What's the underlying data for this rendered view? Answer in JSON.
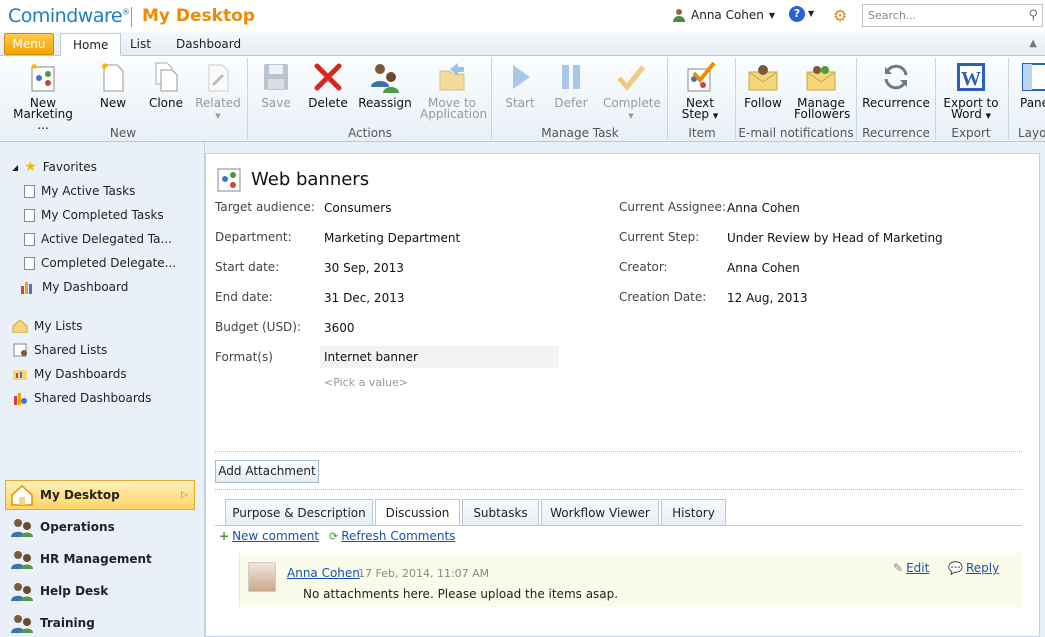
{
  "header": {
    "logo": "Comindware",
    "logo_reg": "®",
    "title": "My Desktop",
    "user": "Anna Cohen",
    "help": "?",
    "search_placeholder": "Search..."
  },
  "tabs": {
    "menu": "Menu",
    "items": [
      "Home",
      "List",
      "Dashboard"
    ]
  },
  "ribbon": {
    "new_marketing": [
      "New",
      "Marketing ..."
    ],
    "new": "New",
    "clone": "Clone",
    "related": "Related",
    "group_new": "New",
    "save": "Save",
    "delete": "Delete",
    "reassign": "Reassign",
    "move": [
      "Move to",
      "Application"
    ],
    "group_actions": "Actions",
    "start": "Start",
    "defer": "Defer",
    "complete": "Complete",
    "group_manage": "Manage Task",
    "next_step": [
      "Next",
      "Step"
    ],
    "group_item": "Item",
    "follow": "Follow",
    "manage_followers": [
      "Manage",
      "Followers"
    ],
    "group_email": "E-mail notifications",
    "recurrence": "Recurrence",
    "group_recurrence": "Recurrence",
    "export_word": [
      "Export to",
      "Word"
    ],
    "group_export": "Export",
    "pane": "Pane",
    "group_layout": "Layo"
  },
  "sidebar": {
    "favorites": "Favorites",
    "fav_items": [
      "My Active Tasks",
      "My Completed Tasks",
      "Active Delegated Ta...",
      "Completed Delegate..."
    ],
    "my_dashboard": "My Dashboard",
    "lists": [
      "My Lists",
      "Shared Lists",
      "My Dashboards",
      "Shared Dashboards"
    ],
    "desktop": "My Desktop",
    "nav": [
      "Operations",
      "HR Management",
      "Help Desk",
      "Training"
    ]
  },
  "task": {
    "title": "Web banners",
    "fields_left": [
      {
        "label": "Target audience:",
        "value": "Consumers"
      },
      {
        "label": "Department:",
        "value": "Marketing Department"
      },
      {
        "label": "Start date:",
        "value": "30 Sep, 2013"
      },
      {
        "label": "End date:",
        "value": "31 Dec, 2013"
      },
      {
        "label": "Budget (USD):",
        "value": "3600"
      }
    ],
    "format_label": "Format(s)",
    "format_value": "Internet banner",
    "pick_value": "<Pick a value>",
    "fields_right": [
      {
        "label": "Current Assignee:",
        "value": "Anna Cohen"
      },
      {
        "label": "Current Step:",
        "value": "Under Review by Head of Marketing"
      },
      {
        "label": "Creator:",
        "value": "Anna Cohen"
      },
      {
        "label": "Creation Date:",
        "value": "12 Aug, 2013"
      }
    ],
    "add_attachment": "Add Attachment"
  },
  "content_tabs": [
    "Purpose & Description",
    "Discussion",
    "Subtasks",
    "Workflow Viewer",
    "History"
  ],
  "discussion": {
    "new_comment": "New comment",
    "refresh": "Refresh Comments",
    "comment": {
      "author": "Anna Cohen",
      "time": "17 Feb, 2014, 11:07 AM",
      "text": "No attachments here. Please upload the items asap.",
      "edit": "Edit",
      "reply": "Reply"
    }
  }
}
